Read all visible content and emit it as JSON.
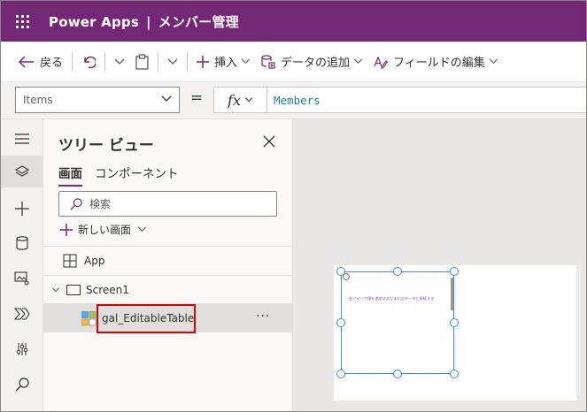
{
  "titlebar": {
    "product": "Power Apps",
    "separator": "|",
    "app_name": "メンバー管理"
  },
  "commandbar": {
    "back": "戻る",
    "insert": "挿入",
    "add_data": "データの追加",
    "edit_fields": "フィールドの編集"
  },
  "formulabar": {
    "property": "Items",
    "equals": "=",
    "fx": "fx",
    "formula": "Members"
  },
  "tree": {
    "title": "ツリー ビュー",
    "tabs": [
      "画面",
      "コンポーネント"
    ],
    "search_placeholder": "検索",
    "new_screen": "新しい画面",
    "items": {
      "app": "App",
      "screen1": "Screen1",
      "gallery": "gal_EditableTable"
    },
    "more": "···"
  },
  "canvas": {
    "gallery_hint": "右ペインで値を追加するかまたはデータに接続する"
  },
  "colors": {
    "titlebar": "#742774",
    "selection": "#3b8fd8",
    "highlight": "#e00000",
    "formula_text": "#1b7f9b"
  }
}
